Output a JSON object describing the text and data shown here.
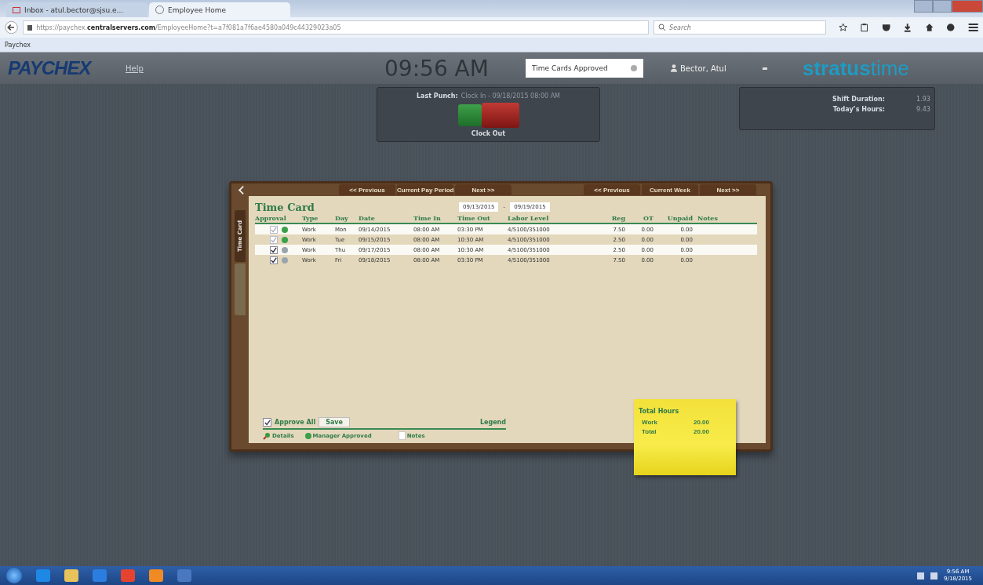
{
  "browser": {
    "tabs": [
      {
        "title": "Inbox - atul.bector@sjsu.e...",
        "kind": "mail",
        "selected": false
      },
      {
        "title": "Employee Home",
        "kind": "page",
        "selected": true
      }
    ],
    "url": "https://paychex.**centralservers.com**/EmployeeHome?t=a7f081a7f6ae4580a049c44329023a05",
    "search": {
      "placeholder": "Search"
    },
    "bookmarks": [
      "Paychex"
    ]
  },
  "header": {
    "logo": "PAYCHEX",
    "help": "Help",
    "time": "09:56 AM",
    "notification": "Time Cards Approved",
    "user": "Bector, Atul",
    "brand_bold": "stratus",
    "brand_light": "time"
  },
  "punch": {
    "label": "Last Punch:",
    "value": "Clock In - 09/18/2015 08:00 AM",
    "button": "Clock Out"
  },
  "shift": [
    {
      "label": "Shift Duration:",
      "value": "1.93"
    },
    {
      "label": "Today’s Hours:",
      "value": "9.43"
    }
  ],
  "timecard": {
    "pay_period_nav": [
      "<< Previous",
      "Current Pay Period",
      "Next >>"
    ],
    "week_nav": [
      "<< Previous",
      "Current Week",
      "Next >>"
    ],
    "side_tabs": [
      {
        "label": "Time Card",
        "selected": true
      },
      {
        "selected": false
      }
    ],
    "title": "Time Card",
    "start_date": "09/13/2015",
    "separator": "-",
    "end_date": "09/19/2015",
    "columns": [
      "Approval",
      "Type",
      "Day",
      "Date",
      "Time In",
      "Time Out",
      "Labor Level",
      "Reg",
      "OT",
      "Unpaid",
      "Notes"
    ],
    "rows": [
      {
        "checked": true,
        "disabled": true,
        "manager_approved": true,
        "type": "Work",
        "day": "Mon",
        "date": "09/14/2015",
        "time_in": "08:00 AM",
        "time_out": "03:30 PM",
        "labor_level": "4/5100/351000",
        "reg": "7.50",
        "ot": "0.00",
        "unpaid": "0.00"
      },
      {
        "checked": true,
        "disabled": true,
        "manager_approved": true,
        "type": "Work",
        "day": "Tue",
        "date": "09/15/2015",
        "time_in": "08:00 AM",
        "time_out": "10:30 AM",
        "labor_level": "4/5100/351000",
        "reg": "2.50",
        "ot": "0.00",
        "unpaid": "0.00"
      },
      {
        "checked": true,
        "disabled": false,
        "manager_approved": false,
        "type": "Work",
        "day": "Thu",
        "date": "09/17/2015",
        "time_in": "08:00 AM",
        "time_out": "10:30 AM",
        "labor_level": "4/5100/351000",
        "reg": "2.50",
        "ot": "0.00",
        "unpaid": "0.00"
      },
      {
        "checked": true,
        "disabled": false,
        "manager_approved": false,
        "type": "Work",
        "day": "Fri",
        "date": "09/18/2015",
        "time_in": "08:00 AM",
        "time_out": "03:30 PM",
        "labor_level": "4/5100/351000",
        "reg": "7.50",
        "ot": "0.00",
        "unpaid": "0.00"
      }
    ],
    "approve_all": {
      "label": "Approve All",
      "checked": true
    },
    "save": "Save",
    "legend": "Legend",
    "legend_items": [
      {
        "kind": "details",
        "label": "Details"
      },
      {
        "kind": "approved",
        "label": "Manager Approved"
      },
      {
        "kind": "notes",
        "label": "Notes"
      }
    ],
    "total_hours": {
      "title": "Total Hours",
      "rows": [
        {
          "label": "Work",
          "value": "20.00"
        },
        {
          "label": "Total",
          "value": "20.00"
        }
      ]
    }
  },
  "taskbar": {
    "apps": [
      {
        "kind": "ie"
      },
      {
        "kind": "folder"
      },
      {
        "kind": "media"
      },
      {
        "kind": "chrome"
      },
      {
        "kind": "firefox"
      },
      {
        "kind": "doc"
      }
    ],
    "time": "9:56 AM",
    "date": "9/18/2015"
  }
}
